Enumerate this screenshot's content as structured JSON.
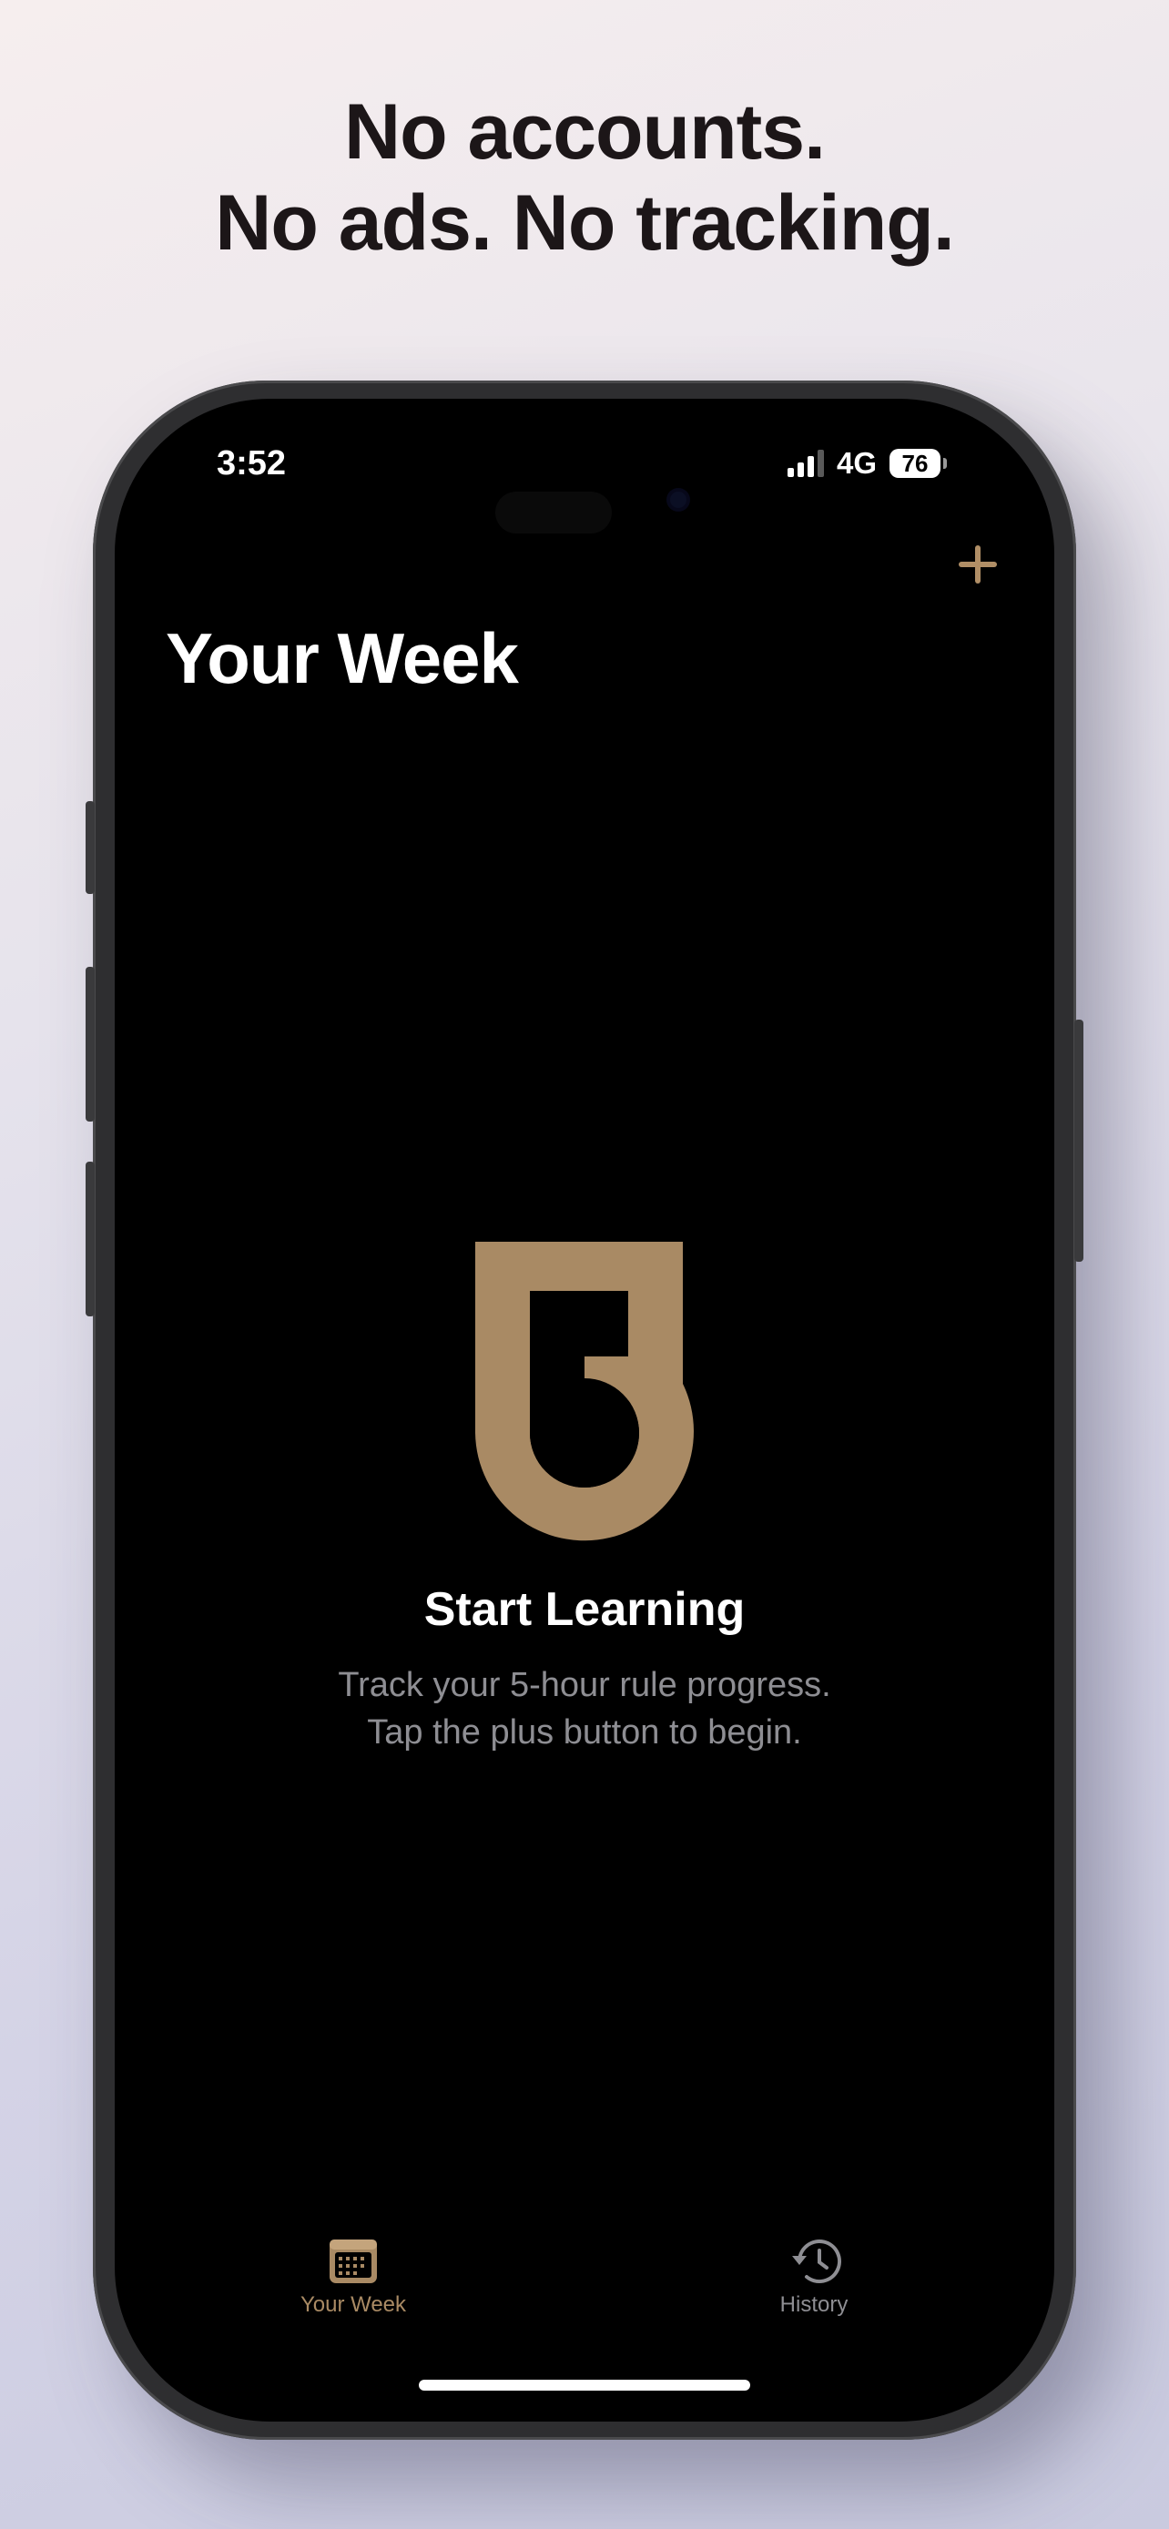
{
  "headline": {
    "line1": "No accounts.",
    "line2": "No ads. No tracking."
  },
  "status_bar": {
    "time": "3:52",
    "network": "4G",
    "battery": "76"
  },
  "nav": {
    "title": "Your Week",
    "add_icon": "plus-icon"
  },
  "empty_state": {
    "logo": "five-logo",
    "title": "Start Learning",
    "line1": "Track your 5-hour rule progress.",
    "line2": "Tap the plus button to begin."
  },
  "tab_bar": {
    "tabs": [
      {
        "label": "Your Week",
        "icon": "calendar-icon",
        "selected": true
      },
      {
        "label": "History",
        "icon": "clock-history-icon",
        "selected": false
      }
    ]
  },
  "colors": {
    "accent": "#a98a64",
    "background": "#000000",
    "secondary_text": "#8e8e93"
  }
}
